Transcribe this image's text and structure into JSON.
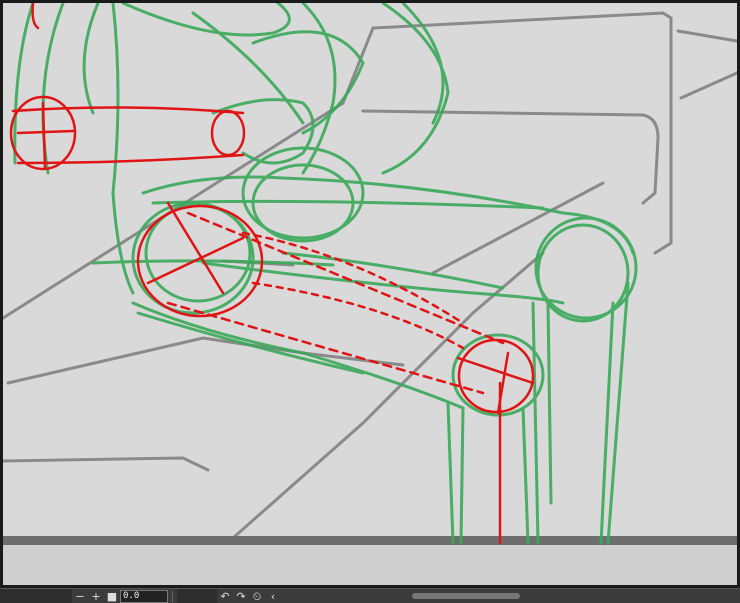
{
  "toolbar": {
    "zoom_out_icon": "minus-icon",
    "zoom_in_icon": "plus-icon",
    "fit_icon": "square-icon",
    "zoom_value": "0.0",
    "rotate_left_icon": "rotate-left-icon",
    "rotate_right_icon": "rotate-right-icon",
    "reset_rotation_icon": "reset-rotation-icon",
    "collapse_icon": "chevron-left-icon",
    "zoom_out_glyph": "−",
    "zoom_in_glyph": "+",
    "fit_glyph": "■",
    "rotate_left_glyph": "↶",
    "rotate_right_glyph": "↷",
    "reset_glyph": "⏲",
    "collapse_glyph": "‹"
  },
  "colors": {
    "canvas_bg": "#d9d9d9",
    "construction_green": "#3aa95a",
    "construction_red": "#e01414",
    "background_lines": "#8a8a8a"
  }
}
